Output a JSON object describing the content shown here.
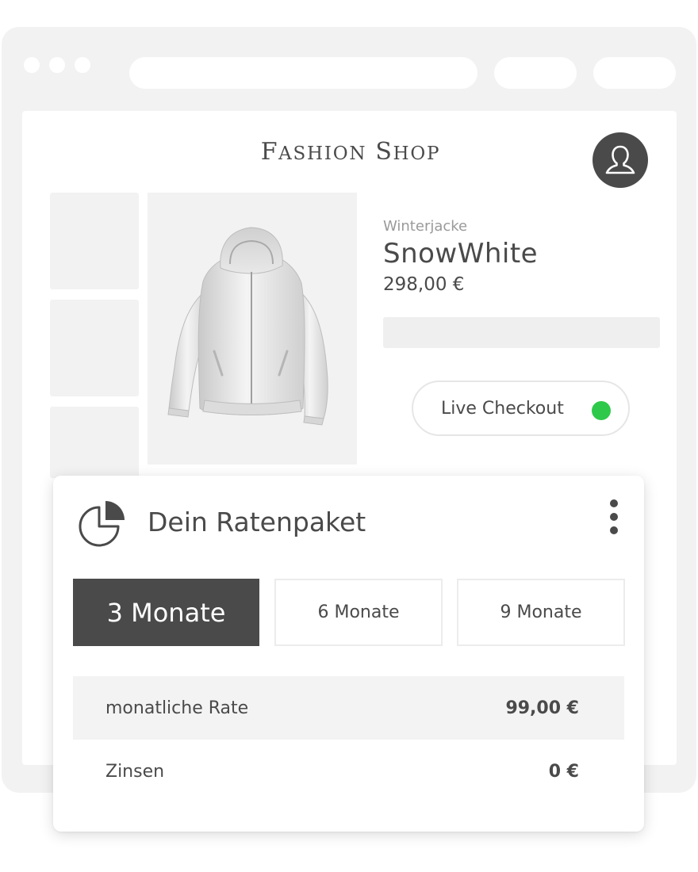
{
  "shop": {
    "logo": "Fashion Shop"
  },
  "product": {
    "category": "Winterjacke",
    "name": "SnowWhite",
    "price": "298,00 €"
  },
  "checkout": {
    "label": "Live Checkout",
    "status_color": "#2ec94a"
  },
  "installments": {
    "title": "Dein Ratenpaket",
    "terms": [
      {
        "label": "3 Monate",
        "selected": true
      },
      {
        "label": "6 Monate",
        "selected": false
      },
      {
        "label": "9 Monate",
        "selected": false
      }
    ],
    "rows": [
      {
        "label": "monatliche Rate",
        "value": "99,00 €"
      },
      {
        "label": "Zinsen",
        "value": "0 €"
      }
    ]
  },
  "icons": {
    "avatar": "user-icon",
    "card": "pie-chart-icon",
    "menu": "more-vertical-icon"
  }
}
